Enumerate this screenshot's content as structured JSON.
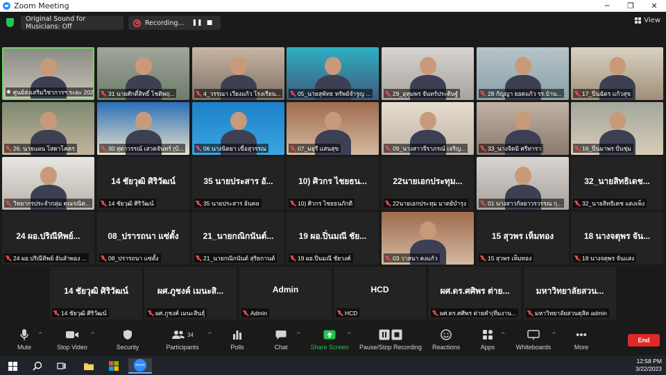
{
  "window": {
    "title": "Zoom Meeting"
  },
  "topbar": {
    "sound_label": "Original Sound for Musicians: Off",
    "recording_label": "Recording...",
    "pause_glyph": "❚❚",
    "stop_glyph": "■",
    "view_label": "View"
  },
  "tiles": [
    {
      "name": "ศูนย์ส่งเสริมวิชาการฯ ระยะ 202",
      "video": true,
      "active": true,
      "muted": false
    },
    {
      "name": "31 นายศักดิ์สิทธิ์ โชติพฤ...",
      "video": true
    },
    {
      "name": "4_วรรณา เวียงแก้ว โรงเรียน...",
      "video": true
    },
    {
      "name": "05_นายสุพัทธ ทรัพย์จำรูญ ...",
      "video": true
    },
    {
      "name": "29_อุทุมพร จันทร์ประดิษฐ์",
      "video": true
    },
    {
      "name": "28 กัญญา ยอดแก้ว รร.บ้าน...",
      "video": true
    },
    {
      "name": "17_ปิ่นฉัตร แก้วสุข",
      "video": true
    },
    {
      "name": "26. นายแผน โสดาโคตร",
      "video": true
    },
    {
      "name": "30 สุดาวรรณ์ เสวตจันทร์ (บ้...",
      "video": true
    },
    {
      "name": "06 นางนิตยา เขื่อสุวรรณ",
      "video": true
    },
    {
      "name": "07_มยุรี แสนสุข",
      "video": true
    },
    {
      "name": "09_นางสาวจีราภรณ์ เจริญ...",
      "video": true
    },
    {
      "name": "33_นางจิตมิ ศรีทารา",
      "video": true
    },
    {
      "name": "16_ปิ่นมาพร ปั่นชุ่ม",
      "video": true
    },
    {
      "name": "วิทยากรประจำกลุ่ม คุณรณิต...",
      "video": true
    },
    {
      "name": "14 ชัยวุฒิ ศิริวัฒน์",
      "big": "14 ชัยวุฒิ ศิริวัฒน์"
    },
    {
      "name": "35 นายประสาร อ้นคล",
      "big": "35 นายประสาร อั..."
    },
    {
      "name": "10) ศิวกร ไชยธนภักดี",
      "big": "10) ศิวกร ไชยธน..."
    },
    {
      "name": "22นายเอกประทุม มาตย์บำรุง",
      "big": "22นายเอกประทุม..."
    },
    {
      "name": "01 นางสาวกัลยาวรวรรณ กุ...",
      "video": true
    },
    {
      "name": "32_นายสิทธิเดช แดงเพ็ง",
      "big": "32_นายสิทธิเดช..."
    },
    {
      "name": "24 ผอ.ปริณีทิพย์ อันลำพอง ...",
      "big": "24 ผอ.ปริณีทิพย์..."
    },
    {
      "name": "08_ปรารถนา แซ่ตั้ง",
      "big": "08_ปรารถนา แซ่ตั้ง"
    },
    {
      "name": "21_นายกณิกนันต์ สุริยกานต์",
      "big": "21_นายกณิกนันต์..."
    },
    {
      "name": "19 ผอ.ปิ่นมณี ชัยวงค์",
      "big": "19 ผอ.ปิ่นมณี ชัย..."
    },
    {
      "name": "03 วาสนา คงแก้ว",
      "video": true
    },
    {
      "name": "15 สุวพร เห็มทอง",
      "big": "15 สุวพร เห็มทอง"
    },
    {
      "name": "18 นางจตุพร จันแสง",
      "big": "18 นางจตุพร จัน..."
    },
    {
      "name": "14 ชัยวุฒิ ศิริวัฒน์",
      "big": "14 ชัยวุฒิ ศิริวัฒน์"
    },
    {
      "name": "ผศ.ภูชงค์ เมนะสินธุ์",
      "big": "ผศ.ภูชงค์ เมนะสิ..."
    },
    {
      "name": "Admin",
      "big": "Admin"
    },
    {
      "name": "HCD",
      "big": "HCD"
    },
    {
      "name": "ผศ.ดร.ศศิพร ต่ายคำ(ทีมงาน...",
      "big": "ผศ.ดร.ศศิพร ต่าย..."
    },
    {
      "name": "มหาวิทยาลัยสวนดุสิต admin",
      "big": "มหาวิทยาลัยสวน..."
    }
  ],
  "toolbar": {
    "mute": "Mute",
    "stop_video": "Stop Video",
    "security": "Security",
    "participants": "Participants",
    "participants_count": "34",
    "polls": "Polls",
    "chat": "Chat",
    "share_screen": "Share Screen",
    "pause_stop_recording": "Pause/Stop Recording",
    "reactions": "Reactions",
    "apps": "Apps",
    "whiteboards": "Whiteboards",
    "more": "More",
    "end": "End"
  },
  "taskbar": {
    "time": "12:58 PM",
    "date": "3/22/2023",
    "zoom_app_label": "zoom"
  },
  "colors": {
    "share_green": "#23c552",
    "end_red": "#e02828",
    "muted_red": "#e34850",
    "active_border": "#6ed65c"
  }
}
